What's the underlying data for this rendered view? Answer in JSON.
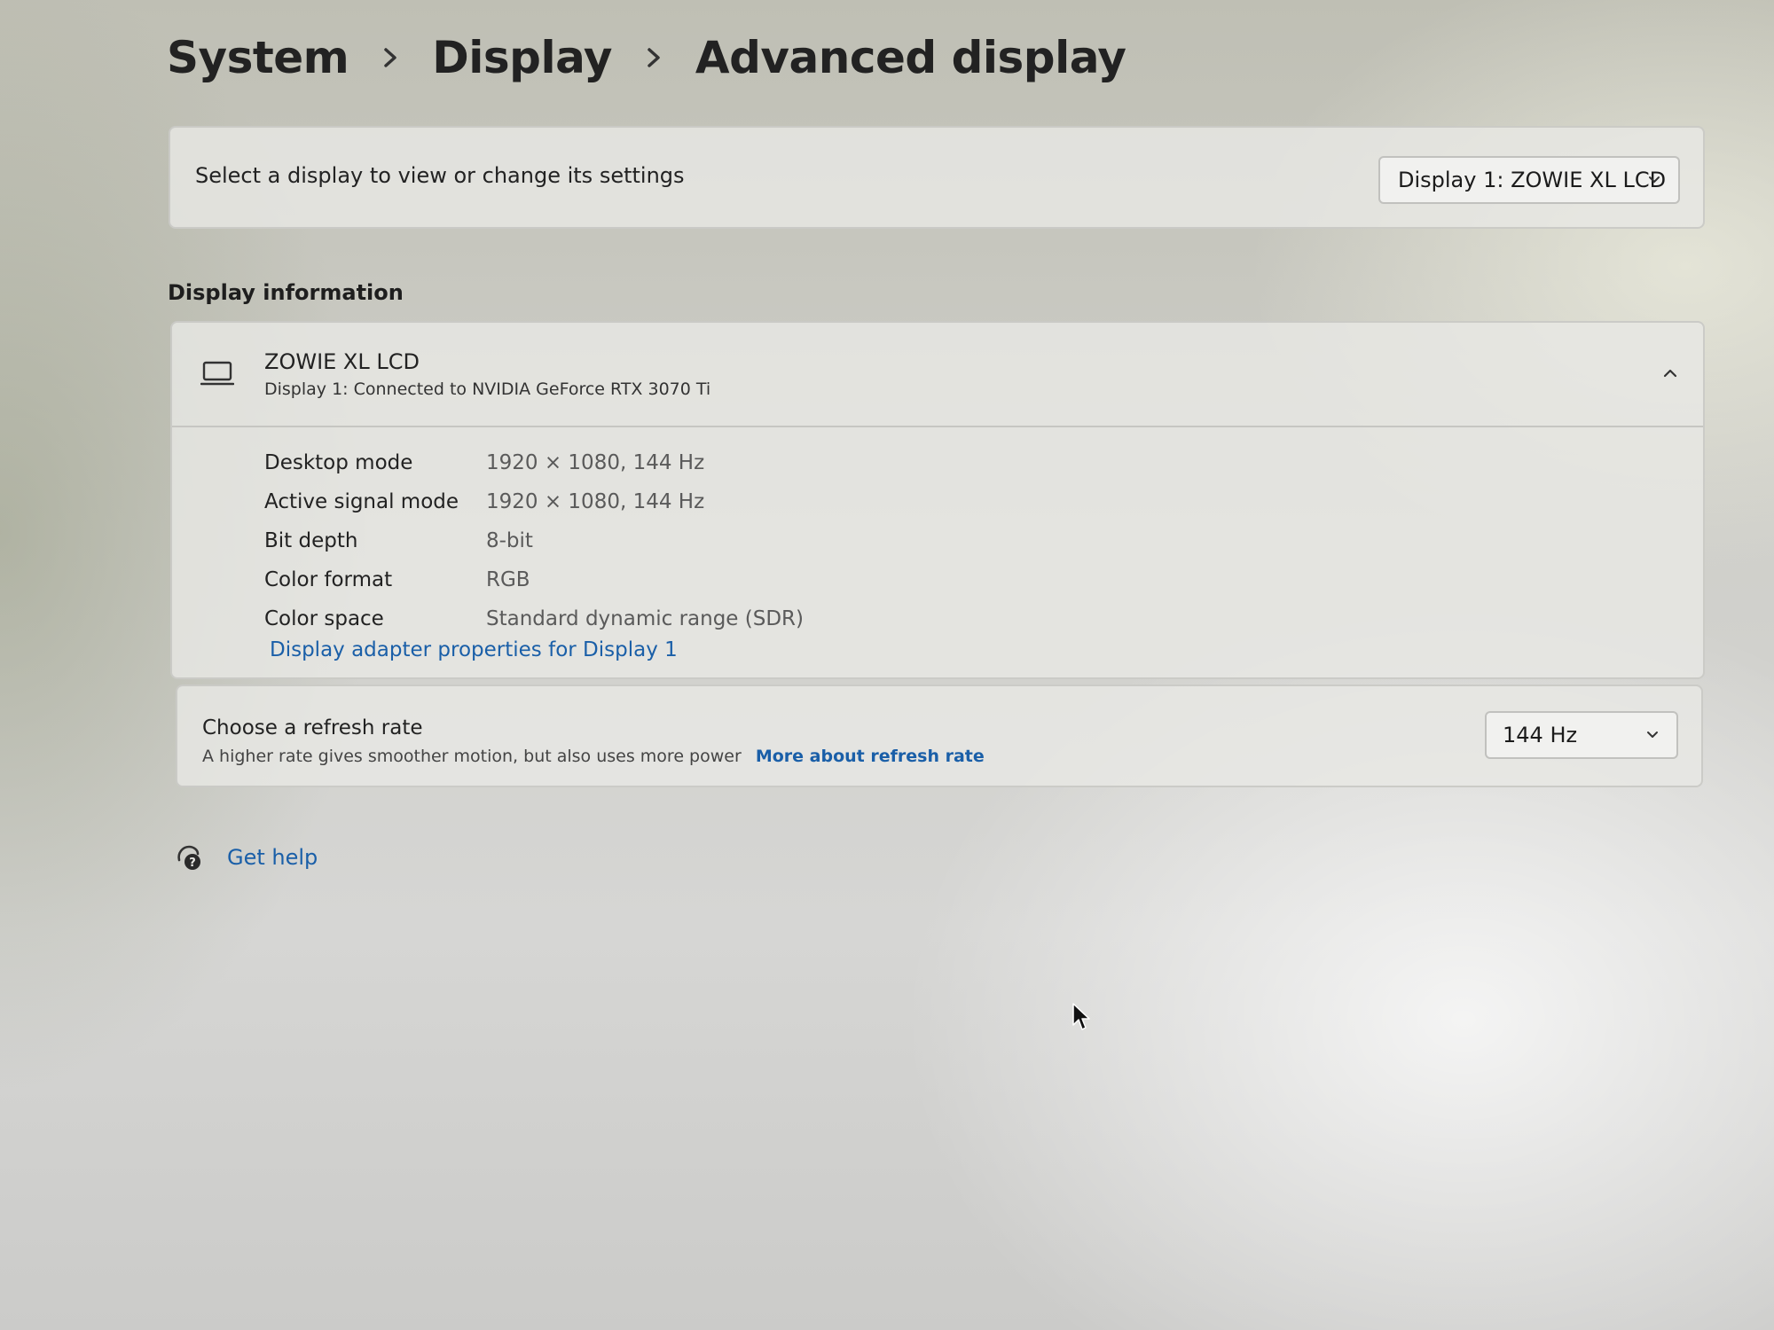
{
  "breadcrumb": {
    "items": [
      "System",
      "Display",
      "Advanced display"
    ],
    "separator_icon": "chevron-right-icon"
  },
  "display_select": {
    "label": "Select a display to view or change its settings",
    "selected": "Display 1: ZOWIE XL LCD",
    "icon": "chevron-down-icon"
  },
  "display_information": {
    "heading": "Display information",
    "icon": "monitor-icon",
    "name": "ZOWIE XL LCD",
    "connection": "Display 1: Connected to NVIDIA GeForce RTX 3070 Ti",
    "expanded": true,
    "rows": [
      {
        "label": "Desktop mode",
        "value": "1920 × 1080, 144 Hz"
      },
      {
        "label": "Active signal mode",
        "value": "1920 × 1080, 144 Hz"
      },
      {
        "label": "Bit depth",
        "value": "8-bit"
      },
      {
        "label": "Color format",
        "value": "RGB"
      },
      {
        "label": "Color space",
        "value": "Standard dynamic range (SDR)"
      }
    ],
    "adapter_link": "Display adapter properties for Display 1"
  },
  "refresh_rate": {
    "title": "Choose a refresh rate",
    "description": "A higher rate gives smoother motion, but also uses more power",
    "link": "More about refresh rate",
    "selected": "144 Hz"
  },
  "help": {
    "label": "Get help",
    "icon": "help-icon"
  },
  "colors": {
    "link": "#1a5fa8",
    "text": "#1b1b1b",
    "secondary_text": "#5a5a5a"
  }
}
